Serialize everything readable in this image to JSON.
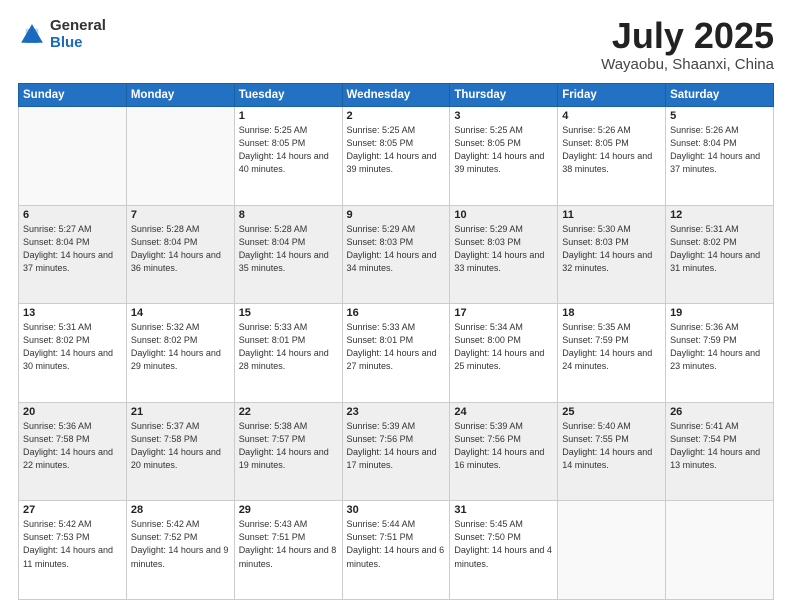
{
  "header": {
    "logo_general": "General",
    "logo_blue": "Blue",
    "title": "July 2025",
    "location": "Wayaobu, Shaanxi, China"
  },
  "weekdays": [
    "Sunday",
    "Monday",
    "Tuesday",
    "Wednesday",
    "Thursday",
    "Friday",
    "Saturday"
  ],
  "weeks": [
    [
      {
        "num": "",
        "sunrise": "",
        "sunset": "",
        "daylight": ""
      },
      {
        "num": "",
        "sunrise": "",
        "sunset": "",
        "daylight": ""
      },
      {
        "num": "1",
        "sunrise": "Sunrise: 5:25 AM",
        "sunset": "Sunset: 8:05 PM",
        "daylight": "Daylight: 14 hours and 40 minutes."
      },
      {
        "num": "2",
        "sunrise": "Sunrise: 5:25 AM",
        "sunset": "Sunset: 8:05 PM",
        "daylight": "Daylight: 14 hours and 39 minutes."
      },
      {
        "num": "3",
        "sunrise": "Sunrise: 5:25 AM",
        "sunset": "Sunset: 8:05 PM",
        "daylight": "Daylight: 14 hours and 39 minutes."
      },
      {
        "num": "4",
        "sunrise": "Sunrise: 5:26 AM",
        "sunset": "Sunset: 8:05 PM",
        "daylight": "Daylight: 14 hours and 38 minutes."
      },
      {
        "num": "5",
        "sunrise": "Sunrise: 5:26 AM",
        "sunset": "Sunset: 8:04 PM",
        "daylight": "Daylight: 14 hours and 37 minutes."
      }
    ],
    [
      {
        "num": "6",
        "sunrise": "Sunrise: 5:27 AM",
        "sunset": "Sunset: 8:04 PM",
        "daylight": "Daylight: 14 hours and 37 minutes."
      },
      {
        "num": "7",
        "sunrise": "Sunrise: 5:28 AM",
        "sunset": "Sunset: 8:04 PM",
        "daylight": "Daylight: 14 hours and 36 minutes."
      },
      {
        "num": "8",
        "sunrise": "Sunrise: 5:28 AM",
        "sunset": "Sunset: 8:04 PM",
        "daylight": "Daylight: 14 hours and 35 minutes."
      },
      {
        "num": "9",
        "sunrise": "Sunrise: 5:29 AM",
        "sunset": "Sunset: 8:03 PM",
        "daylight": "Daylight: 14 hours and 34 minutes."
      },
      {
        "num": "10",
        "sunrise": "Sunrise: 5:29 AM",
        "sunset": "Sunset: 8:03 PM",
        "daylight": "Daylight: 14 hours and 33 minutes."
      },
      {
        "num": "11",
        "sunrise": "Sunrise: 5:30 AM",
        "sunset": "Sunset: 8:03 PM",
        "daylight": "Daylight: 14 hours and 32 minutes."
      },
      {
        "num": "12",
        "sunrise": "Sunrise: 5:31 AM",
        "sunset": "Sunset: 8:02 PM",
        "daylight": "Daylight: 14 hours and 31 minutes."
      }
    ],
    [
      {
        "num": "13",
        "sunrise": "Sunrise: 5:31 AM",
        "sunset": "Sunset: 8:02 PM",
        "daylight": "Daylight: 14 hours and 30 minutes."
      },
      {
        "num": "14",
        "sunrise": "Sunrise: 5:32 AM",
        "sunset": "Sunset: 8:02 PM",
        "daylight": "Daylight: 14 hours and 29 minutes."
      },
      {
        "num": "15",
        "sunrise": "Sunrise: 5:33 AM",
        "sunset": "Sunset: 8:01 PM",
        "daylight": "Daylight: 14 hours and 28 minutes."
      },
      {
        "num": "16",
        "sunrise": "Sunrise: 5:33 AM",
        "sunset": "Sunset: 8:01 PM",
        "daylight": "Daylight: 14 hours and 27 minutes."
      },
      {
        "num": "17",
        "sunrise": "Sunrise: 5:34 AM",
        "sunset": "Sunset: 8:00 PM",
        "daylight": "Daylight: 14 hours and 25 minutes."
      },
      {
        "num": "18",
        "sunrise": "Sunrise: 5:35 AM",
        "sunset": "Sunset: 7:59 PM",
        "daylight": "Daylight: 14 hours and 24 minutes."
      },
      {
        "num": "19",
        "sunrise": "Sunrise: 5:36 AM",
        "sunset": "Sunset: 7:59 PM",
        "daylight": "Daylight: 14 hours and 23 minutes."
      }
    ],
    [
      {
        "num": "20",
        "sunrise": "Sunrise: 5:36 AM",
        "sunset": "Sunset: 7:58 PM",
        "daylight": "Daylight: 14 hours and 22 minutes."
      },
      {
        "num": "21",
        "sunrise": "Sunrise: 5:37 AM",
        "sunset": "Sunset: 7:58 PM",
        "daylight": "Daylight: 14 hours and 20 minutes."
      },
      {
        "num": "22",
        "sunrise": "Sunrise: 5:38 AM",
        "sunset": "Sunset: 7:57 PM",
        "daylight": "Daylight: 14 hours and 19 minutes."
      },
      {
        "num": "23",
        "sunrise": "Sunrise: 5:39 AM",
        "sunset": "Sunset: 7:56 PM",
        "daylight": "Daylight: 14 hours and 17 minutes."
      },
      {
        "num": "24",
        "sunrise": "Sunrise: 5:39 AM",
        "sunset": "Sunset: 7:56 PM",
        "daylight": "Daylight: 14 hours and 16 minutes."
      },
      {
        "num": "25",
        "sunrise": "Sunrise: 5:40 AM",
        "sunset": "Sunset: 7:55 PM",
        "daylight": "Daylight: 14 hours and 14 minutes."
      },
      {
        "num": "26",
        "sunrise": "Sunrise: 5:41 AM",
        "sunset": "Sunset: 7:54 PM",
        "daylight": "Daylight: 14 hours and 13 minutes."
      }
    ],
    [
      {
        "num": "27",
        "sunrise": "Sunrise: 5:42 AM",
        "sunset": "Sunset: 7:53 PM",
        "daylight": "Daylight: 14 hours and 11 minutes."
      },
      {
        "num": "28",
        "sunrise": "Sunrise: 5:42 AM",
        "sunset": "Sunset: 7:52 PM",
        "daylight": "Daylight: 14 hours and 9 minutes."
      },
      {
        "num": "29",
        "sunrise": "Sunrise: 5:43 AM",
        "sunset": "Sunset: 7:51 PM",
        "daylight": "Daylight: 14 hours and 8 minutes."
      },
      {
        "num": "30",
        "sunrise": "Sunrise: 5:44 AM",
        "sunset": "Sunset: 7:51 PM",
        "daylight": "Daylight: 14 hours and 6 minutes."
      },
      {
        "num": "31",
        "sunrise": "Sunrise: 5:45 AM",
        "sunset": "Sunset: 7:50 PM",
        "daylight": "Daylight: 14 hours and 4 minutes."
      },
      {
        "num": "",
        "sunrise": "",
        "sunset": "",
        "daylight": ""
      },
      {
        "num": "",
        "sunrise": "",
        "sunset": "",
        "daylight": ""
      }
    ]
  ]
}
